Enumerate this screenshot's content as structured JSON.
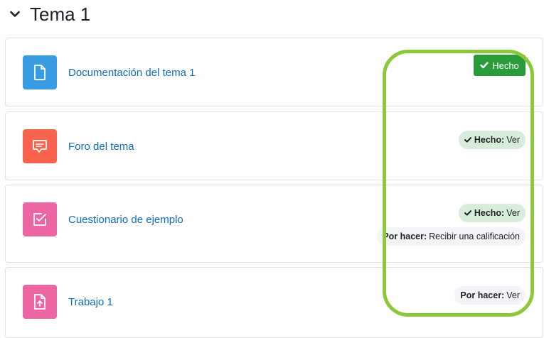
{
  "section": {
    "title": "Tema 1"
  },
  "activities": [
    {
      "name": "Documentación del tema 1",
      "icon": "document-icon",
      "icon_color": "#399be2",
      "completion": {
        "type": "manual",
        "label": "Hecho"
      }
    },
    {
      "name": "Foro del tema",
      "icon": "forum-icon",
      "icon_color": "#f7634d",
      "completion": {
        "type": "auto",
        "items": [
          {
            "status": "Hecho:",
            "text": "Ver"
          }
        ]
      }
    },
    {
      "name": "Cuestionario de ejemplo",
      "icon": "quiz-icon",
      "icon_color": "#eb66a2",
      "completion": {
        "type": "auto",
        "items": [
          {
            "status": "Hecho:",
            "text": "Ver"
          },
          {
            "status": "Por hacer:",
            "text": "Recibir una calificación"
          }
        ]
      }
    },
    {
      "name": "Trabajo 1",
      "icon": "assignment-icon",
      "icon_color": "#eb66a2",
      "completion": {
        "type": "auto",
        "items": [
          {
            "status": "Por hacer:",
            "text": "Ver"
          }
        ]
      }
    }
  ],
  "colors": {
    "link": "#0f6cbf",
    "done_button": "#2a9d3a",
    "done_pill": "#d7ecd9",
    "todo_pill": "#f3f4f6",
    "highlight": "#8cc83a"
  }
}
